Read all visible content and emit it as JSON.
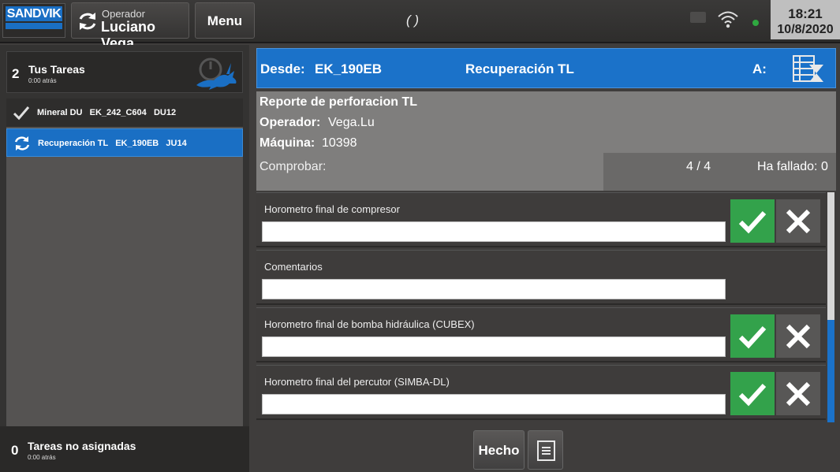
{
  "topbar": {
    "logo_text": "SANDVIK",
    "operator_label": "Operador",
    "operator_name": "Luciano Vega",
    "menu_label": "Menu",
    "center_text": "( )",
    "time": "18:21",
    "date": "10/8/2020"
  },
  "sidebar": {
    "tasks_count": "2",
    "tasks_title": "Tus Tareas",
    "tasks_sub": "0:00 atrás",
    "items": [
      {
        "label": "Mineral DU   EK_242_C604   DU12",
        "icon": "checkmark-icon",
        "selected": false
      },
      {
        "label": "Recuperación TL   EK_190EB   JU14",
        "icon": "refresh-icon",
        "selected": true
      }
    ],
    "unassigned_count": "0",
    "unassigned_title": "Tareas no asignadas",
    "unassigned_sub": "0:00 atrás"
  },
  "route": {
    "from_label": "Desde:",
    "from_value": "EK_190EB",
    "task_name": "Recuperación TL",
    "to_label": "A:"
  },
  "report": {
    "title": "Reporte de perforacion TL",
    "operator_label": "Operador:",
    "operator_value": "Vega.Lu",
    "machine_label": "Máquina:",
    "machine_value": "10398",
    "check_label": "Comprobar:",
    "check_ratio": "4 / 4",
    "failed": "Ha fallado: 0"
  },
  "fields": [
    {
      "label": "Horometro final de compresor",
      "value": "",
      "has_buttons": true
    },
    {
      "label": "Comentarios",
      "value": "",
      "has_buttons": false
    },
    {
      "label": "Horometro final de bomba hidráulica (CUBEX)",
      "value": "",
      "has_buttons": true
    },
    {
      "label": "Horometro final del percutor (SIMBA-DL)",
      "value": "",
      "has_buttons": true
    }
  ],
  "footer": {
    "done_label": "Hecho"
  },
  "colors": {
    "accent_blue": "#1b72c9",
    "ok_green": "#33a24b",
    "status_dot": "#2fa840"
  }
}
